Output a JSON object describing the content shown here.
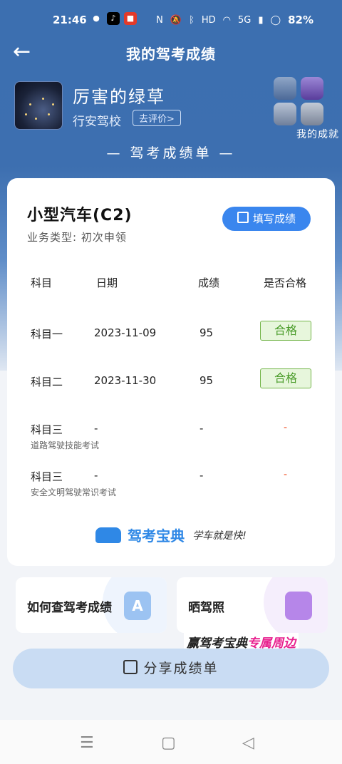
{
  "status_bar": {
    "time": "21:46",
    "network": "5G",
    "battery": "82%"
  },
  "nav": {
    "title": "我的驾考成绩"
  },
  "profile": {
    "name": "厉害的绿草",
    "school": "行安驾校",
    "review_button": "去评价>",
    "achievements_label": "我的成就"
  },
  "sheet_title": "— 驾考成绩单 —",
  "card": {
    "vehicle_type": "小型汽车(C2)",
    "business_type": "业务类型: 初次申领",
    "fill_button": "填写成绩",
    "columns": [
      "科目",
      "日期",
      "成绩",
      "是否合格"
    ],
    "rows": [
      {
        "subject": "科目一",
        "subtitle": "",
        "date": "2023-11-09",
        "score": "95",
        "pass": "合格"
      },
      {
        "subject": "科目二",
        "subtitle": "",
        "date": "2023-11-30",
        "score": "95",
        "pass": "合格"
      },
      {
        "subject": "科目三",
        "subtitle": "道路驾驶技能考试",
        "date": "-",
        "score": "-",
        "pass": "-"
      },
      {
        "subject": "科目三",
        "subtitle": "安全文明驾驶常识考试",
        "date": "-",
        "score": "-",
        "pass": "-"
      }
    ],
    "brand_name": "驾考宝典",
    "brand_slogan": "学车就是快!"
  },
  "tiles": {
    "check_scores": "如何查驾考成绩",
    "show_license": "晒驾照"
  },
  "promo": {
    "prefix": "赢驾考宝典",
    "highlight": "专属周边"
  },
  "share_button": "分享成绩单",
  "colors": {
    "header_blue": "#3c6fb0",
    "accent_blue": "#3a86ee",
    "pass_green": "#4a9c2a",
    "pending_red": "#f0552c"
  }
}
